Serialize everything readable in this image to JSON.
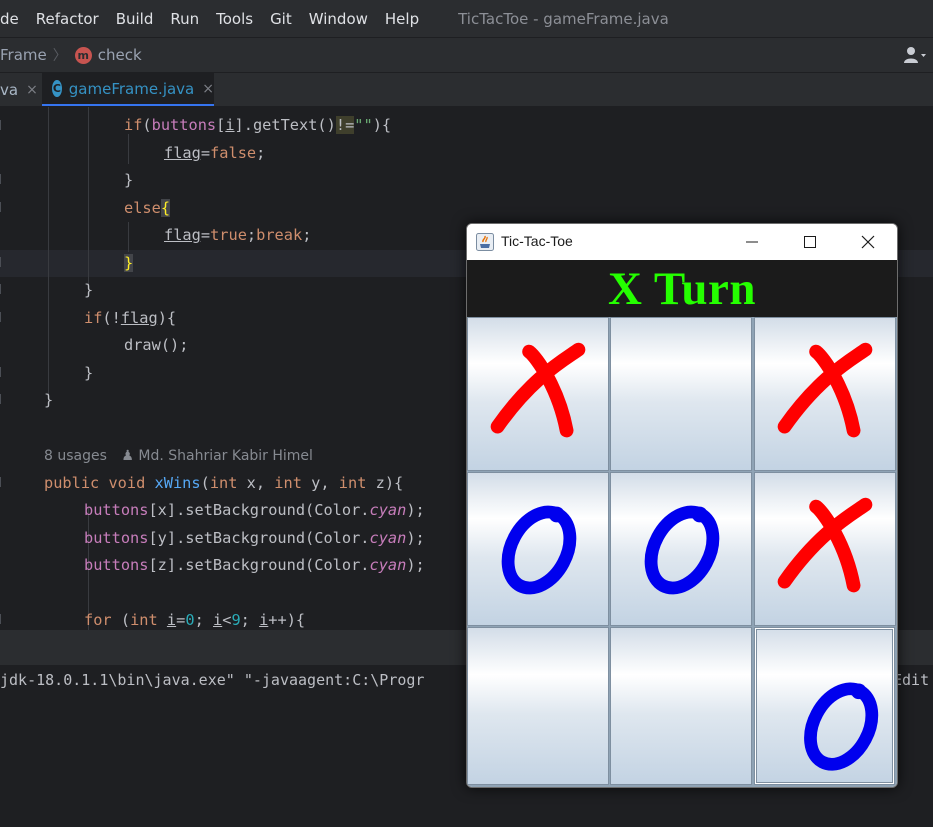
{
  "menubar": {
    "items": [
      "de",
      "Refactor",
      "Build",
      "Run",
      "Tools",
      "Git",
      "Window",
      "Help"
    ],
    "window_title": "TicTacToe - gameFrame.java"
  },
  "navbar": {
    "crumb_class": "Frame",
    "crumb_method_badge": "m",
    "crumb_method": "check"
  },
  "tabs": [
    {
      "label": "va",
      "close": "×"
    },
    {
      "label": "gameFrame.java",
      "icon": "C",
      "close": "×"
    }
  ],
  "editor": {
    "usages": "8 usages",
    "author": "Md. Shahriar Kabir Himel"
  },
  "console": {
    "line": "jdk-18.0.1.1\\bin\\java.exe\" \"-javaagent:C:\\Progr",
    "edit": "Edit"
  },
  "game_window": {
    "title": "Tic-Tac-Toe",
    "turn_text": "X Turn",
    "turn_color": "#25ff00",
    "x_color": "#ff0000",
    "o_color": "#0000ee",
    "board": [
      "X",
      "",
      "X",
      "O",
      "O",
      "X",
      "",
      "",
      "O"
    ]
  }
}
